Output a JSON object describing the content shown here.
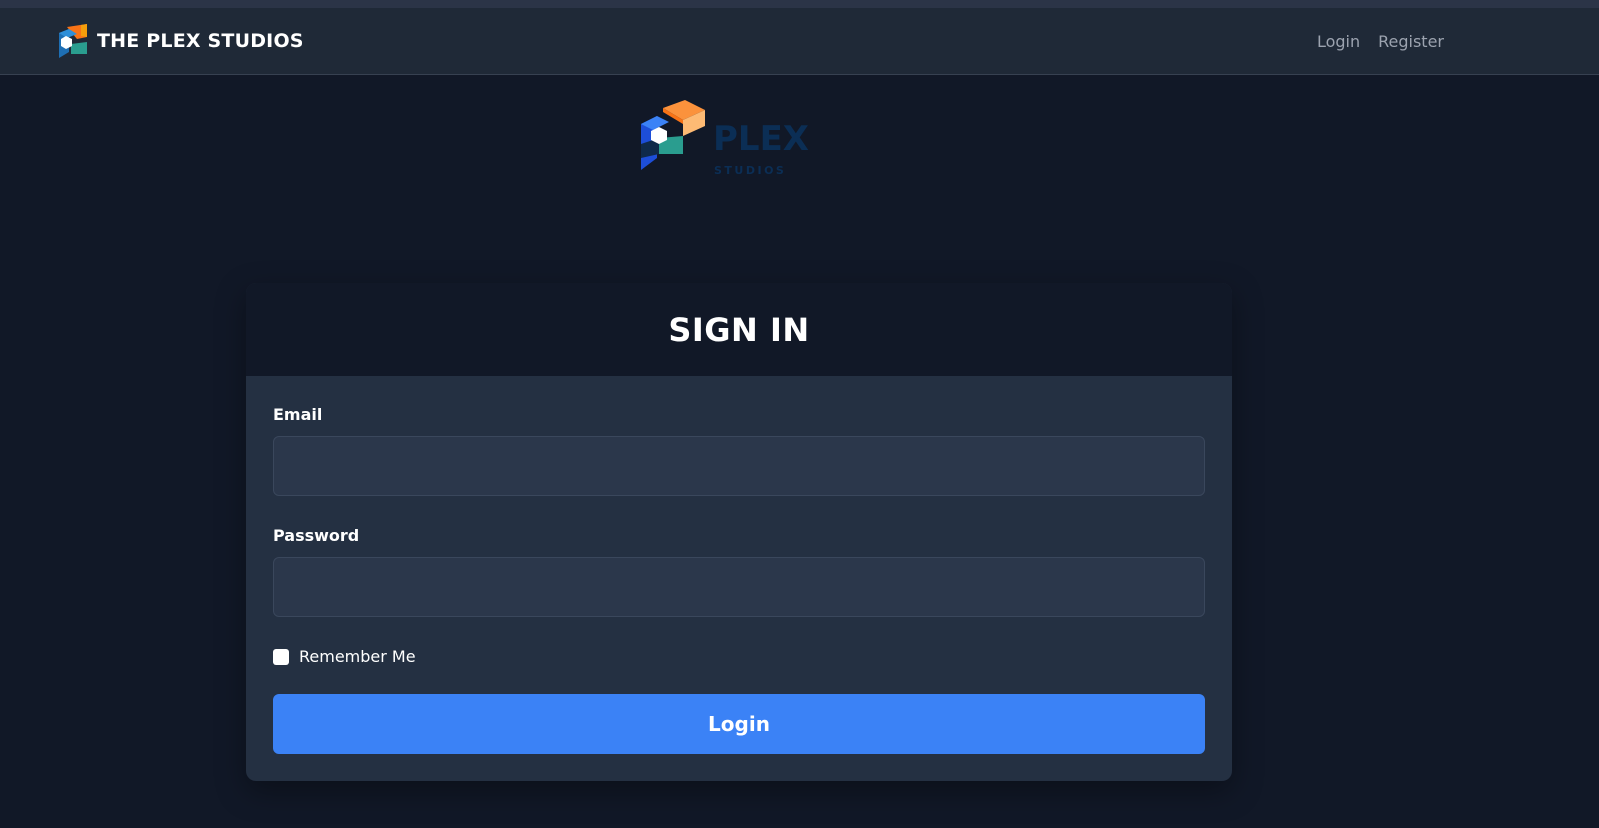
{
  "navbar": {
    "brand_name": "THE PLEX STUDIOS",
    "brand_icon": "plex-cube-icon",
    "links": [
      {
        "label": "Login"
      },
      {
        "label": "Register"
      }
    ]
  },
  "hero_logo": {
    "icon": "plex-studios-logo",
    "wordmark": "PLEX",
    "tagline": "STUDIOS"
  },
  "signin": {
    "title": "SIGN IN",
    "email": {
      "label": "Email",
      "value": "",
      "placeholder": ""
    },
    "password": {
      "label": "Password",
      "value": "",
      "placeholder": ""
    },
    "remember_label": "Remember Me",
    "remember_checked": false,
    "submit_label": "Login"
  },
  "colors": {
    "background": "#111827",
    "navbar": "#1f2937",
    "card": "#243042",
    "input": "#2b374b",
    "accent": "#3b82f6",
    "logo_orange": "#f97316",
    "logo_teal": "#2a9d8f",
    "logo_blue": "#1e6fb4"
  }
}
